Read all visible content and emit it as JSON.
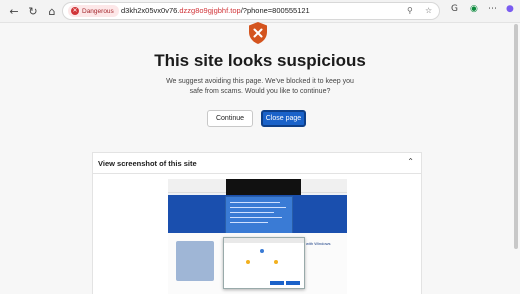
{
  "browser": {
    "security_label": "Dangerous",
    "url_prefix": "d3kh2x05vx0v76.",
    "url_danger": "dzzg8o9gjgbhf.top",
    "url_suffix": "/?phone=800555121",
    "icons": [
      "back-icon",
      "refresh-icon",
      "home-icon",
      "danger-icon",
      "zoom-icon",
      "favorite-icon",
      "sync-icon",
      "extensions-icon",
      "copilot-icon"
    ]
  },
  "warning": {
    "headline": "This site looks suspicious",
    "message": "We suggest avoiding this page. We've blocked it to keep you safe from scams. Would you like to continue?",
    "continue_label": "Continue",
    "close_label": "Close page",
    "accent_color": "#d4541e",
    "primary_color": "#1a62c9"
  },
  "screenshot_panel": {
    "title": "View screenshot of this site",
    "thumb_text": "with Windows"
  }
}
